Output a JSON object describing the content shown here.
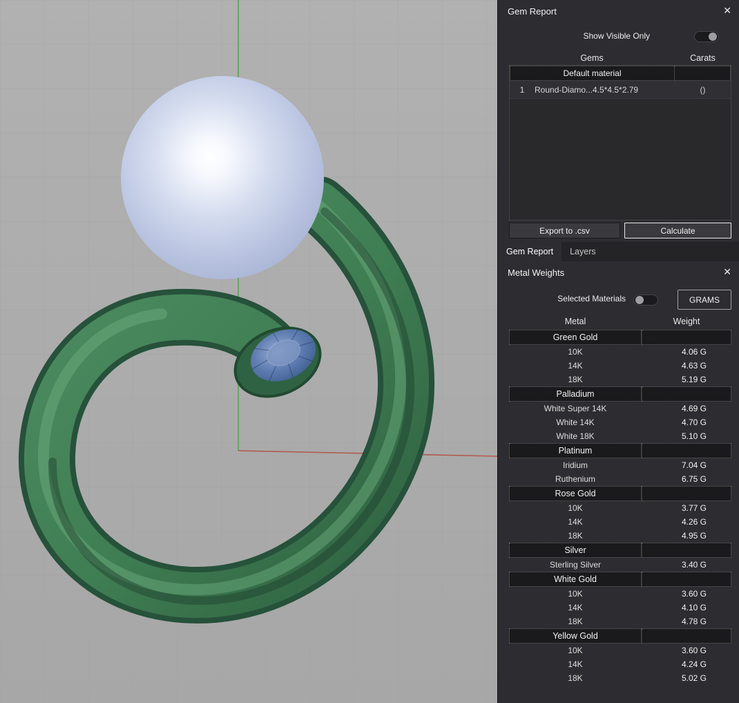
{
  "colors": {
    "viewport_bg": "#acacac",
    "grid_line": "#9e9e9e",
    "axis_green": "#55a055",
    "axis_red": "#b05a4c",
    "ring_metal_green": "#3f7d52",
    "pearl_sphere": "#b3bedd",
    "gem_blue": "#4c6ea3",
    "panel_bg": "#2d2d31",
    "table_header_bg": "#1a1a1c"
  },
  "gem_report": {
    "title": "Gem Report",
    "close_label": "✕",
    "show_visible_only_label": "Show Visible Only",
    "show_visible_only_on": true,
    "columns": {
      "gems": "Gems",
      "carats": "Carats"
    },
    "group_header": "Default material",
    "rows": [
      {
        "index": "1",
        "name": "Round-Diamo...",
        "size": "4.5*4.5*2.79",
        "carats": "()"
      }
    ],
    "export_button": "Export to .csv",
    "calculate_button": "Calculate"
  },
  "tabs": [
    {
      "label": "Gem Report",
      "active": true
    },
    {
      "label": "Layers",
      "active": false
    }
  ],
  "metal_weights": {
    "title": "Metal Weights",
    "close_label": "✕",
    "selected_materials_label": "Selected Materials",
    "selected_materials_on": false,
    "grams_button": "GRAMS",
    "columns": {
      "metal": "Metal",
      "weight": "Weight"
    },
    "groups": [
      {
        "name": "Green Gold",
        "rows": [
          [
            "10K",
            "4.06 G"
          ],
          [
            "14K",
            "4.63 G"
          ],
          [
            "18K",
            "5.19 G"
          ]
        ]
      },
      {
        "name": "Palladium",
        "rows": [
          [
            "White Super 14K",
            "4.69 G"
          ],
          [
            "White 14K",
            "4.70 G"
          ],
          [
            "White 18K",
            "5.10 G"
          ]
        ]
      },
      {
        "name": "Platinum",
        "rows": [
          [
            "Iridium",
            "7.04 G"
          ],
          [
            "Ruthenium",
            "6.75 G"
          ]
        ]
      },
      {
        "name": "Rose Gold",
        "rows": [
          [
            "10K",
            "3.77 G"
          ],
          [
            "14K",
            "4.26 G"
          ],
          [
            "18K",
            "4.95 G"
          ]
        ]
      },
      {
        "name": "Silver",
        "rows": [
          [
            "Sterling Silver",
            "3.40 G"
          ]
        ]
      },
      {
        "name": "White Gold",
        "rows": [
          [
            "10K",
            "3.60 G"
          ],
          [
            "14K",
            "4.10 G"
          ],
          [
            "18K",
            "4.78 G"
          ]
        ]
      },
      {
        "name": "Yellow Gold",
        "rows": [
          [
            "10K",
            "3.60 G"
          ],
          [
            "14K",
            "4.24 G"
          ],
          [
            "18K",
            "5.02 G"
          ]
        ]
      }
    ]
  }
}
